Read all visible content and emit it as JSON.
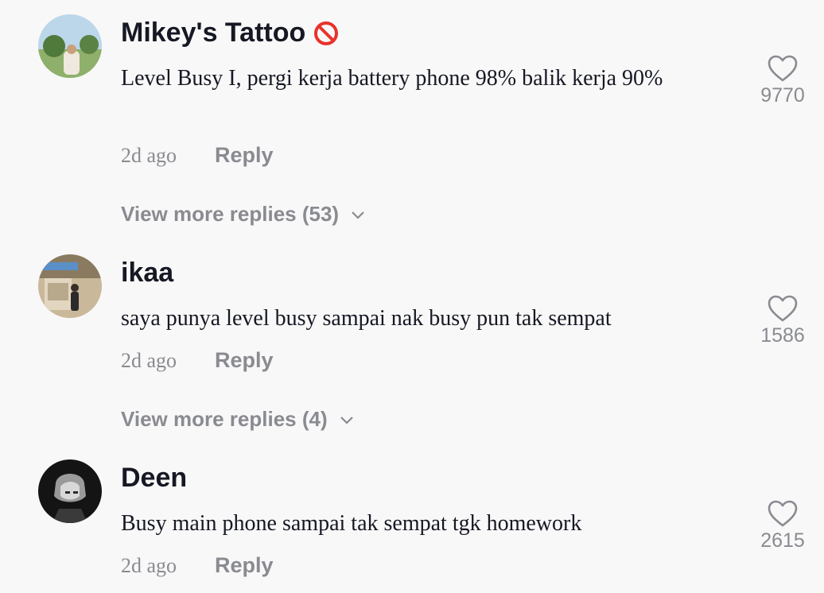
{
  "comments": [
    {
      "username": "Mikey's Tattoo",
      "badge_icon": "prohibited-icon",
      "text": "Level Busy I, pergi kerja battery phone 98% balik kerja 90%",
      "time": "2d ago",
      "reply_label": "Reply",
      "likes": "9770",
      "view_more": "View more replies (53)"
    },
    {
      "username": "ikaa",
      "text": "saya punya level busy sampai nak busy pun tak sempat",
      "time": "2d ago",
      "reply_label": "Reply",
      "likes": "1586",
      "view_more": "View more replies (4)"
    },
    {
      "username": "Deen",
      "text": "Busy main phone sampai tak sempat tgk homework",
      "time": "2d ago",
      "reply_label": "Reply",
      "likes": "2615"
    }
  ],
  "colors": {
    "background": "#f8f8f8",
    "primary_text": "#161823",
    "secondary_text": "#8a8b91",
    "badge_red": "#e8322c"
  }
}
